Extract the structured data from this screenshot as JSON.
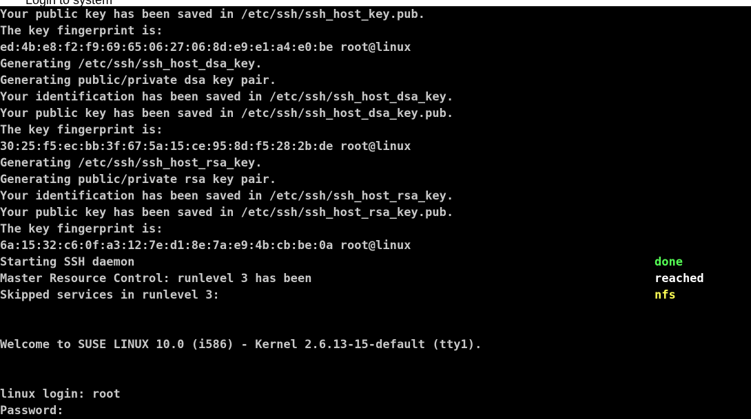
{
  "caption": "Login to system",
  "console": {
    "lines": [
      "Your public key has been saved in /etc/ssh/ssh_host_key.pub.",
      "The key fingerprint is:",
      "ed:4b:e8:f2:f9:69:65:06:27:06:8d:e9:e1:a4:e0:be root@linux",
      "Generating /etc/ssh/ssh_host_dsa_key.",
      "Generating public/private dsa key pair.",
      "Your identification has been saved in /etc/ssh/ssh_host_dsa_key.",
      "Your public key has been saved in /etc/ssh/ssh_host_dsa_key.pub.",
      "The key fingerprint is:",
      "30:25:f5:ec:bb:3f:67:5a:15:ce:95:8d:f5:28:2b:de root@linux",
      "Generating /etc/ssh/ssh_host_rsa_key.",
      "Generating public/private rsa key pair.",
      "Your identification has been saved in /etc/ssh/ssh_host_rsa_key.",
      "Your public key has been saved in /etc/ssh/ssh_host_rsa_key.pub.",
      "The key fingerprint is:",
      "6a:15:32:c6:0f:a3:12:7e:d1:8e:7a:e9:4b:cb:be:0a root@linux",
      "Starting SSH daemon",
      "Master Resource Control: runlevel 3 has been",
      "Skipped services in runlevel 3:",
      "",
      "",
      "Welcome to SUSE LINUX 10.0 (i586) - Kernel 2.6.13-15-default (tty1).",
      "",
      "",
      "linux login: root",
      "Password:"
    ],
    "statuses": [
      {
        "text": "done",
        "kind": "done",
        "color": "#55ff55"
      },
      {
        "text": "reached",
        "kind": "reached",
        "color": "#ffffff"
      },
      {
        "text": "nfs",
        "kind": "nfs",
        "color": "#ffff55"
      }
    ]
  },
  "colors": {
    "background": "#000000",
    "text": "#c8c8c8"
  }
}
